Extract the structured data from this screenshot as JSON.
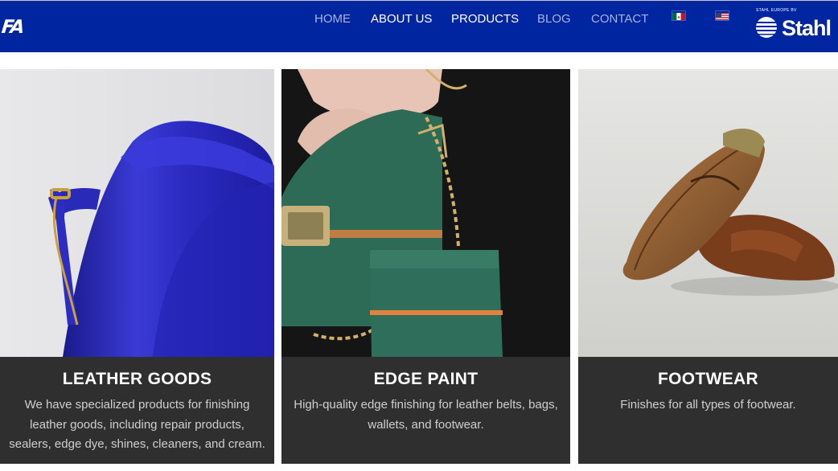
{
  "header": {
    "logo_text": "FA",
    "nav": [
      {
        "label": "HOME",
        "active": false
      },
      {
        "label": "ABOUT US",
        "active": true
      },
      {
        "label": "PRODUCTS",
        "active": true
      },
      {
        "label": "BLOG",
        "active": false
      },
      {
        "label": "CONTACT",
        "active": false
      }
    ],
    "flags": [
      "mexico-flag-icon",
      "usa-flag-icon"
    ],
    "brand": {
      "small_text": "STAHL EUROPE BV",
      "name": "Stahl"
    },
    "colors": {
      "navbar": "#0025a0",
      "nav_dim": "#a9b4d9",
      "nav_bright": "#ffffff"
    }
  },
  "cards": [
    {
      "title": "LEATHER GOODS",
      "lines": [
        "We have specialized products for finishing",
        "leather goods, including repair products,",
        "sealers, edge dye, shines, cleaners, and cream."
      ],
      "image": "blue-leather-bag-image"
    },
    {
      "title": "EDGE PAINT",
      "lines": [
        "High-quality edge finishing for leather belts, bags,",
        "wallets, and footwear."
      ],
      "image": "green-handbag-image"
    },
    {
      "title": "FOOTWEAR",
      "lines": [
        "Finishes for all types of footwear."
      ],
      "image": "brown-shoes-image"
    }
  ],
  "colors": {
    "card_bg": "#2f2f2f",
    "card_text": "#cfcfcf",
    "title": "#ffffff"
  }
}
